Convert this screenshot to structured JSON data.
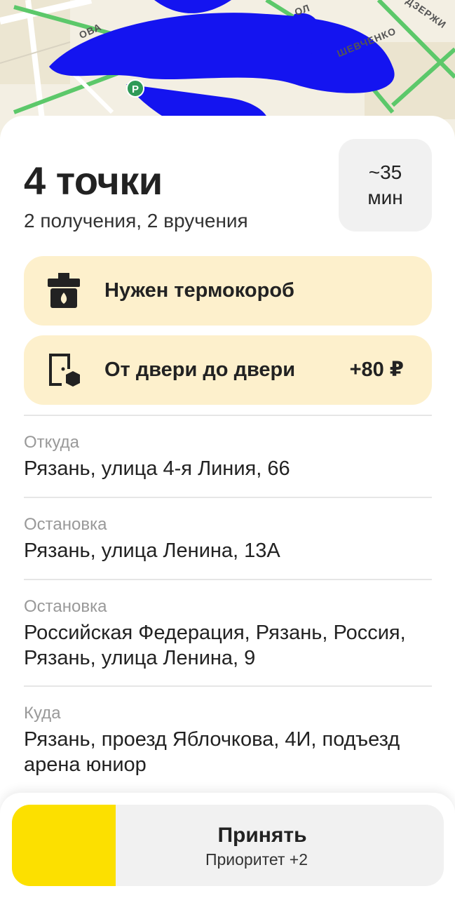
{
  "map": {
    "street_labels": [
      "ОВА",
      "ОЛ",
      "ДЗЕРЖИ",
      "ШЕВЧЕНКО"
    ],
    "parking_icon": "parking-icon",
    "scribble_color": "#1414f0"
  },
  "order": {
    "title": "4 точки",
    "subtitle": "2 получения, 2 вручения",
    "eta_value": "~35",
    "eta_unit": "мин"
  },
  "requirements": [
    {
      "icon": "thermal-box-icon",
      "label": "Нужен термокороб",
      "extra": ""
    },
    {
      "icon": "door-to-door-icon",
      "label": "От двери до двери",
      "extra": "+80 ₽"
    }
  ],
  "route": [
    {
      "kind": "Откуда",
      "address": "Рязань, улица 4-я Линия, 66"
    },
    {
      "kind": "Остановка",
      "address": "Рязань, улица Ленина, 13А"
    },
    {
      "kind": "Остановка",
      "address": "Российская Федерация, Рязань, Россия, Рязань, улица Ленина, 9"
    },
    {
      "kind": "Куда",
      "address": "Рязань, проезд Яблочкова, 4И, подъезд арена юниор"
    }
  ],
  "accept": {
    "label": "Принять",
    "priority": "Приоритет +2",
    "progress_fraction": 0.24
  },
  "colors": {
    "accent_yellow": "#fce000",
    "pill_background": "#fdf0cc",
    "eta_background": "#f1f1f1"
  }
}
